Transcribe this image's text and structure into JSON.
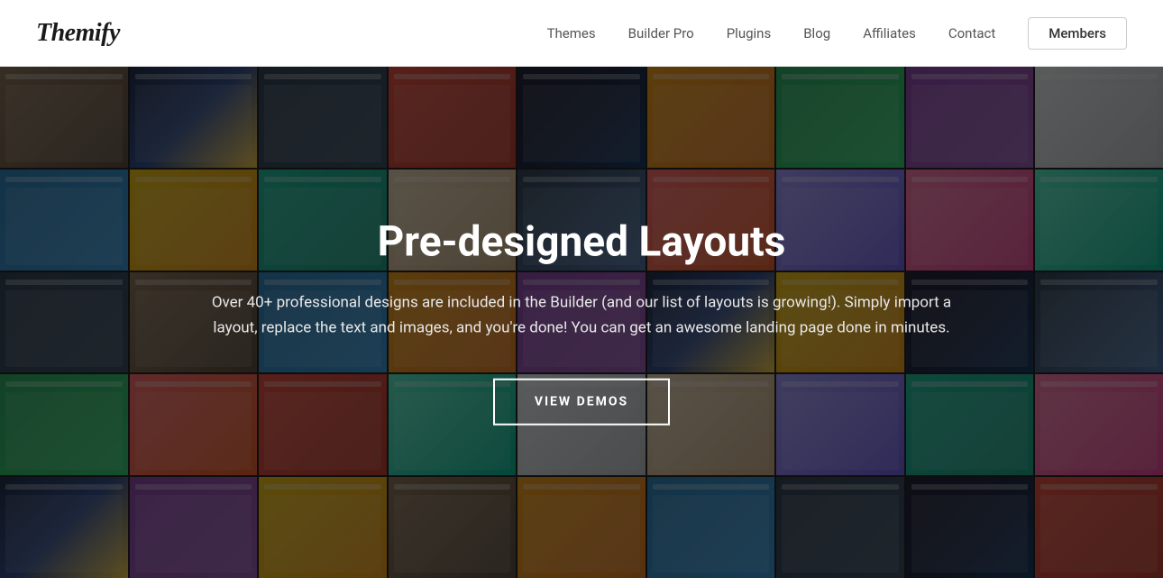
{
  "header": {
    "logo_text": "Themify",
    "nav": {
      "links": [
        {
          "label": "Themes",
          "href": "#"
        },
        {
          "label": "Builder Pro",
          "href": "#"
        },
        {
          "label": "Plugins",
          "href": "#"
        },
        {
          "label": "Blog",
          "href": "#"
        },
        {
          "label": "Affiliates",
          "href": "#"
        },
        {
          "label": "Contact",
          "href": "#"
        }
      ],
      "members_label": "Members"
    }
  },
  "hero": {
    "title": "Pre-designed Layouts",
    "description": "Over 40+ professional designs are included in the Builder (and our list of layouts is growing!). Simply import a layout, replace the text and images, and you're done! You can get an awesome landing page done in minutes.",
    "cta_label": "VIEW DEMOS",
    "mosaic_cells": 45
  }
}
